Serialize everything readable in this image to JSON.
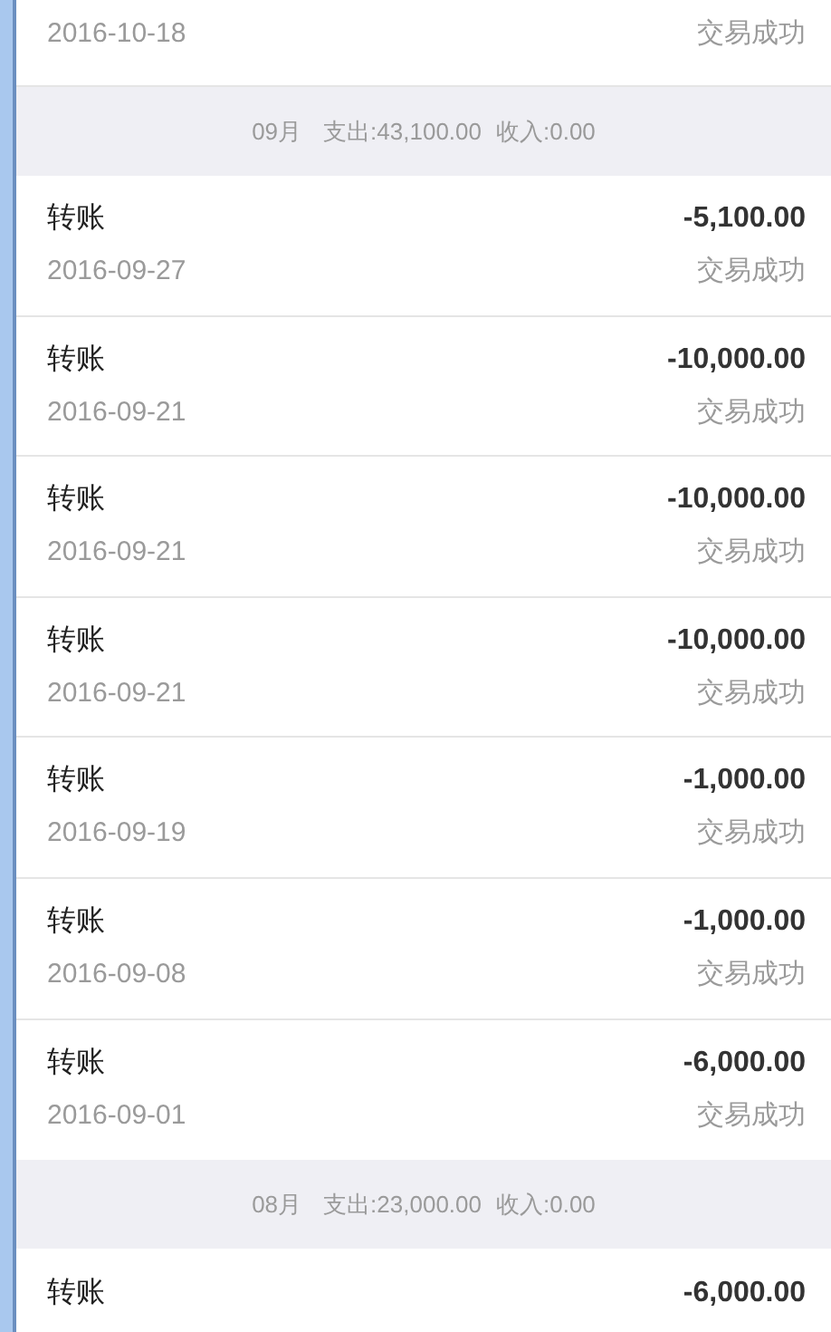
{
  "top_partial_row": {
    "date": "2016-10-18",
    "status": "交易成功"
  },
  "months": [
    {
      "month": "09月",
      "expense": "支出:43,100.00",
      "income": "收入:0.00",
      "records": [
        {
          "title": "转账",
          "amount": "-5,100.00",
          "date": "2016-09-27",
          "status": "交易成功"
        },
        {
          "title": "转账",
          "amount": "-10,000.00",
          "date": "2016-09-21",
          "status": "交易成功"
        },
        {
          "title": "转账",
          "amount": "-10,000.00",
          "date": "2016-09-21",
          "status": "交易成功"
        },
        {
          "title": "转账",
          "amount": "-10,000.00",
          "date": "2016-09-21",
          "status": "交易成功"
        },
        {
          "title": "转账",
          "amount": "-1,000.00",
          "date": "2016-09-19",
          "status": "交易成功"
        },
        {
          "title": "转账",
          "amount": "-1,000.00",
          "date": "2016-09-08",
          "status": "交易成功"
        },
        {
          "title": "转账",
          "amount": "-6,000.00",
          "date": "2016-09-01",
          "status": "交易成功"
        }
      ]
    },
    {
      "month": "08月",
      "expense": "支出:23,000.00",
      "income": "收入:0.00",
      "records": [
        {
          "title": "转账",
          "amount": "-6,000.00"
        }
      ]
    }
  ]
}
